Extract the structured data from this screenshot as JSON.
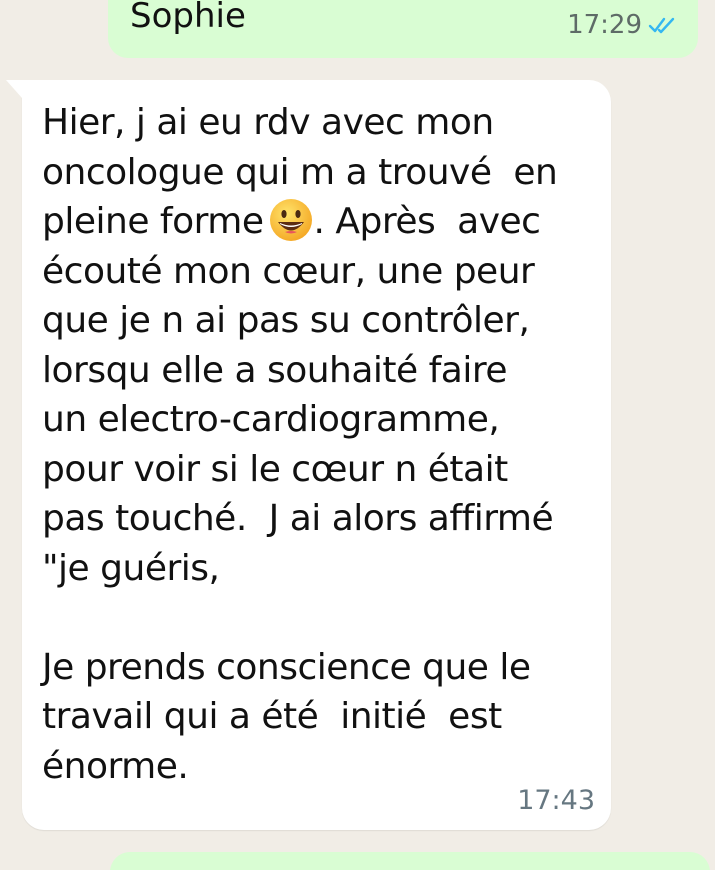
{
  "messages": {
    "outgoing_top": {
      "text": "Sophie",
      "time": "17:29",
      "status_icon": "double-check-read-icon",
      "status_color": "#34B7F1"
    },
    "incoming": {
      "lines": [
        "Hier, j ai eu rdv avec mon",
        "oncologue qui m a trouvé  en",
        "pleine forme",
        ". Après  avec",
        "écouté mon cœur, une peur",
        "que je n ai pas su contrôler,",
        "lorsqu elle a souhaité faire",
        "un electro-cardiogramme,",
        "pour voir si le cœur n était",
        "pas touché.  J ai alors affirmé",
        "\"je guéris,",
        "Je prends conscience que le",
        "travail qui a été  initié  est",
        "énorme."
      ],
      "emoji": "grinning-face-emoji",
      "time": "17:43"
    }
  },
  "colors": {
    "chat_background": "#F1EDE6",
    "outgoing_bubble": "#D9FDD3",
    "incoming_bubble": "#FFFFFF"
  }
}
